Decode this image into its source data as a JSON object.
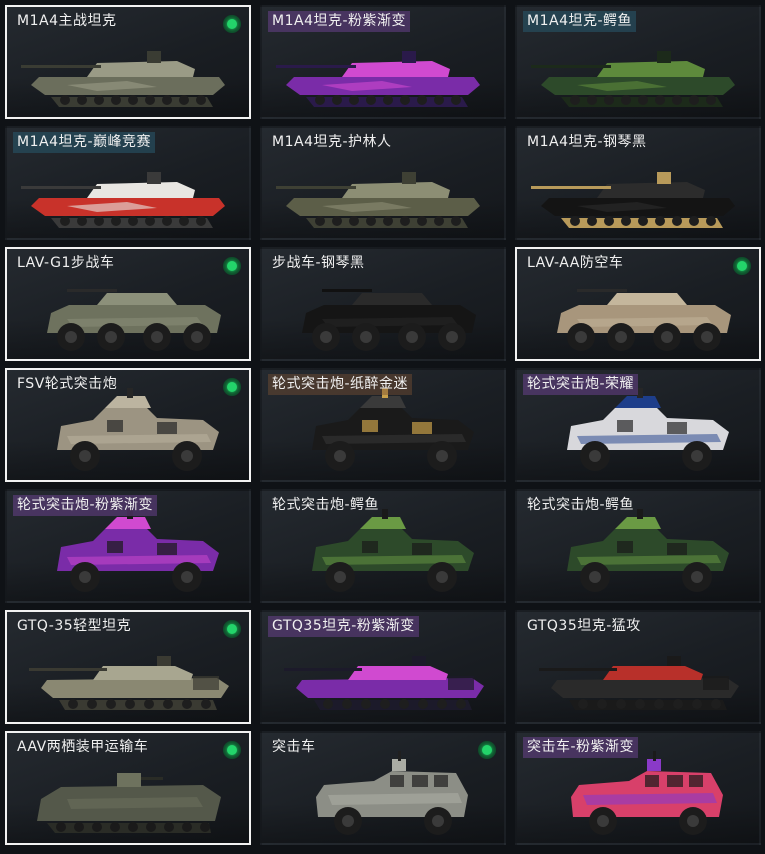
{
  "items": [
    {
      "label": "M1A4主战坦克",
      "type": "tank",
      "selected": true,
      "owned": true,
      "tint": "none",
      "colors": [
        "#6b6e5c",
        "#9a9b86",
        "#3a3c33"
      ]
    },
    {
      "label": "M1A4坦克-粉紫渐变",
      "type": "tank",
      "selected": false,
      "owned": false,
      "tint": "purple",
      "colors": [
        "#7a2ca8",
        "#d04ad0",
        "#2a1a4a"
      ]
    },
    {
      "label": "M1A4坦克-鳄鱼",
      "type": "tank",
      "selected": false,
      "owned": false,
      "tint": "teal",
      "colors": [
        "#2d4a2a",
        "#5e8a3c",
        "#1c2a1a"
      ]
    },
    {
      "label": "M1A4坦克-巅峰竞赛",
      "type": "tank",
      "selected": false,
      "owned": false,
      "tint": "teal",
      "colors": [
        "#c8322a",
        "#e8e6e2",
        "#3a3a3a"
      ]
    },
    {
      "label": "M1A4坦克-护林人",
      "type": "tank",
      "selected": false,
      "owned": false,
      "tint": "none",
      "colors": [
        "#5c5e48",
        "#8c8e74",
        "#3e4034"
      ]
    },
    {
      "label": "M1A4坦克-钢琴黑",
      "type": "tank",
      "selected": false,
      "owned": false,
      "tint": "none",
      "colors": [
        "#141414",
        "#2c2c2c",
        "#b89a5a"
      ]
    },
    {
      "label": "LAV-G1步战车",
      "type": "lav",
      "selected": true,
      "owned": true,
      "tint": "none",
      "colors": [
        "#6e725e",
        "#8c907a",
        "#2a2a2a"
      ]
    },
    {
      "label": "步战车-钢琴黑",
      "type": "lav",
      "selected": false,
      "owned": false,
      "tint": "none",
      "colors": [
        "#151515",
        "#2a2a2a",
        "#111111"
      ]
    },
    {
      "label": "LAV-AA防空车",
      "type": "lav",
      "selected": true,
      "owned": true,
      "tint": "none",
      "colors": [
        "#a8967c",
        "#c4b69c",
        "#2a2a2a"
      ]
    },
    {
      "label": "FSV轮式突击炮",
      "type": "fsv",
      "selected": true,
      "owned": true,
      "tint": "none",
      "colors": [
        "#9c9482",
        "#bcb4a0",
        "#262626"
      ]
    },
    {
      "label": "轮式突击炮-纸醉金迷",
      "type": "fsv",
      "selected": false,
      "owned": false,
      "tint": "brown",
      "colors": [
        "#1a1a1a",
        "#3a3a3a",
        "#c8a04a"
      ]
    },
    {
      "label": "轮式突击炮-荣耀",
      "type": "fsv",
      "selected": false,
      "owned": false,
      "tint": "purple",
      "colors": [
        "#d8d8dc",
        "#1e3e8a",
        "#262626"
      ]
    },
    {
      "label": "轮式突击炮-粉紫渐变",
      "type": "fsv",
      "selected": false,
      "owned": false,
      "tint": "purple",
      "colors": [
        "#7a2ca8",
        "#d04ad0",
        "#1a1a1a"
      ]
    },
    {
      "label": "轮式突击炮-鳄鱼",
      "type": "fsv",
      "selected": false,
      "owned": false,
      "tint": "none",
      "colors": [
        "#2d4a2a",
        "#6a9a44",
        "#1a1a1a"
      ]
    },
    {
      "label": "轮式突击炮-鳄鱼",
      "type": "fsv",
      "selected": false,
      "owned": false,
      "tint": "none",
      "colors": [
        "#2d4a2a",
        "#6a9a44",
        "#1a1a1a"
      ]
    },
    {
      "label": "GTQ-35轻型坦克",
      "type": "light",
      "selected": true,
      "owned": true,
      "tint": "none",
      "colors": [
        "#8a8872",
        "#a8a690",
        "#3a3a32"
      ]
    },
    {
      "label": "GTQ35坦克-粉紫渐变",
      "type": "light",
      "selected": false,
      "owned": false,
      "tint": "purple",
      "colors": [
        "#7a2ca8",
        "#d04ad0",
        "#1c1a2a"
      ]
    },
    {
      "label": "GTQ35坦克-猛攻",
      "type": "light",
      "selected": false,
      "owned": false,
      "tint": "none",
      "colors": [
        "#2a2a2a",
        "#b8302a",
        "#1a1a1a"
      ]
    },
    {
      "label": "AAV两栖装甲运输车",
      "type": "aav",
      "selected": true,
      "owned": true,
      "tint": "none",
      "colors": [
        "#54584a",
        "#6e725e",
        "#2a2c26"
      ]
    },
    {
      "label": "突击车",
      "type": "suv",
      "selected": false,
      "owned": true,
      "tint": "none",
      "colors": [
        "#8c8e86",
        "#aaaca4",
        "#202020"
      ]
    },
    {
      "label": "突击车-粉紫渐变",
      "type": "suv",
      "selected": false,
      "owned": false,
      "tint": "purple",
      "colors": [
        "#d8406a",
        "#8a3ac8",
        "#1a1a1a"
      ]
    }
  ]
}
